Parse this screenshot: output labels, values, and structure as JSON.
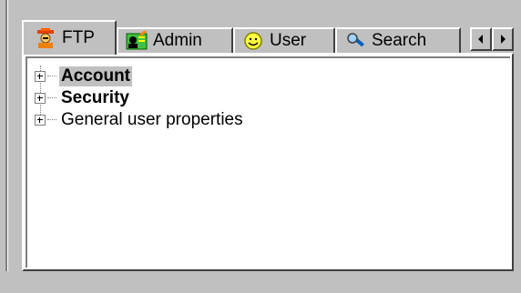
{
  "tabs": [
    {
      "label": "FTP",
      "icon": "ftp-person-icon"
    },
    {
      "label": "Admin",
      "icon": "admin-card-icon"
    },
    {
      "label": "User",
      "icon": "smiley-icon"
    },
    {
      "label": "Search",
      "icon": "magnifier-icon"
    }
  ],
  "tree": {
    "items": [
      {
        "label": "Account"
      },
      {
        "label": "Security"
      },
      {
        "label": "General user properties"
      }
    ]
  },
  "colors": {
    "face": "#c0c0c0",
    "panel": "#ffffff"
  }
}
